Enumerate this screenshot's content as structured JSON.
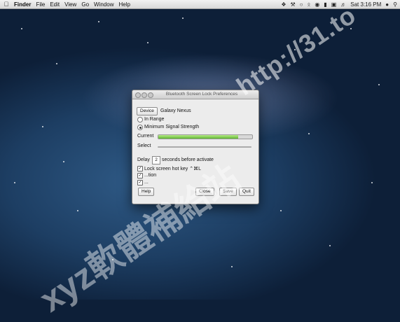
{
  "menubar": {
    "apple_icon": "apple-icon",
    "app_name": "Finder",
    "menus": [
      "File",
      "Edit",
      "View",
      "Go",
      "Window",
      "Help"
    ],
    "clock": "Sat 3:16 PM",
    "status_icons": [
      "dropbox-icon",
      "wrench-icon",
      "lock-icon",
      "bluetooth-icon",
      "wifi-icon",
      "battery-icon",
      "display-icon",
      "volume-icon",
      "user-icon",
      "search-icon"
    ]
  },
  "window": {
    "title": "Bluetooth Screen Lock Preferences",
    "device_button": "Device",
    "device_name": "Galaxy Nexus",
    "radio_in_range": "In Range",
    "radio_min_signal": "Minimum Signal Strength",
    "selected_radio": "Minimum Signal Strength",
    "current_label": "Current",
    "current_signal_fraction": 0.85,
    "select_label": "Select",
    "delay_prefix": "Delay",
    "delay_value": "2",
    "delay_suffix": "seconds before activate",
    "checkbox_lock_screen": "Lock screen hot key ⌃⌘L",
    "checkbox_2": "...tion",
    "checkbox_3": "...",
    "help_button": "Help",
    "close_button": "Close",
    "save_button": "Save",
    "quit_button": "Quit"
  },
  "watermark": {
    "url": "http://31.to",
    "site": "xyz軟體補給站"
  },
  "colors": {
    "signal_fill": "#5fb630",
    "desktop_blue": "#1d3e63"
  }
}
